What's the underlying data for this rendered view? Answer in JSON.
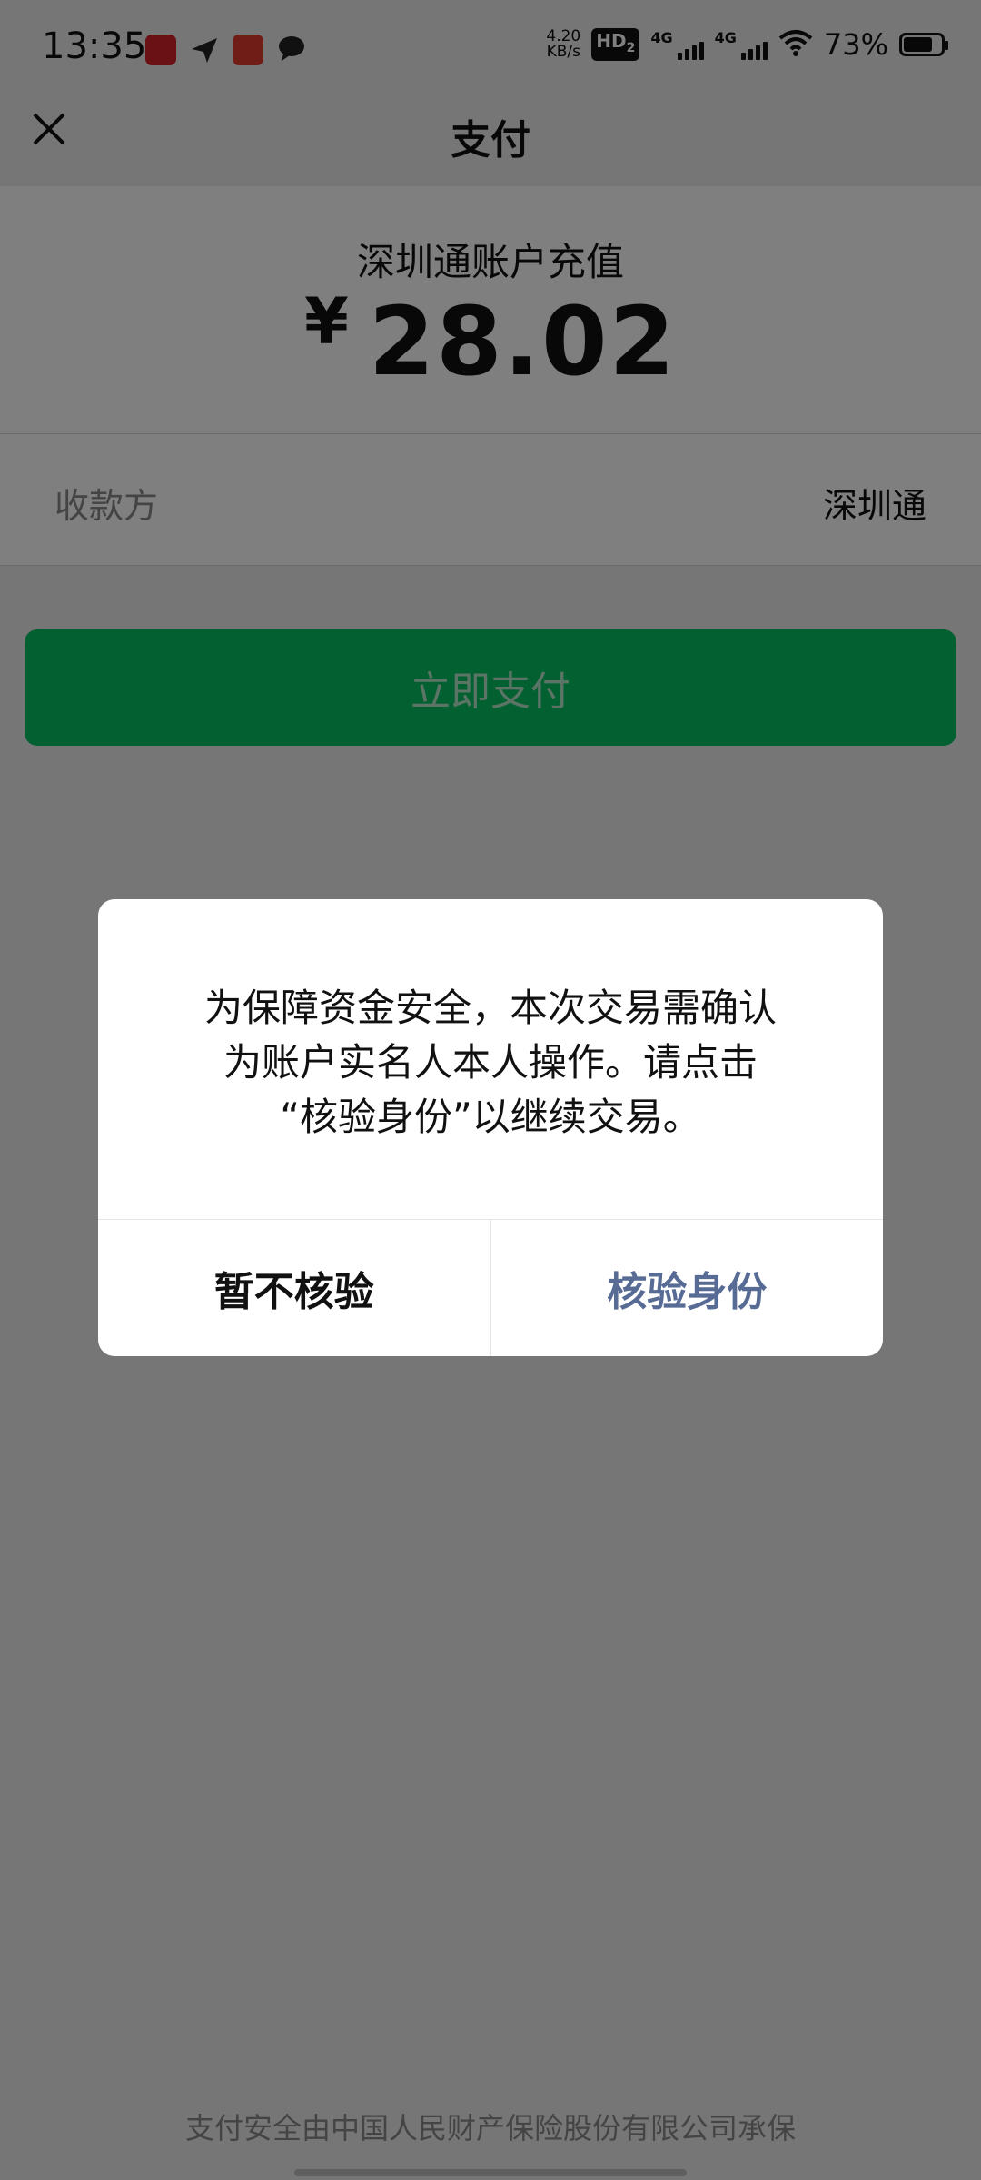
{
  "status_bar": {
    "time": "13:35",
    "net_speed_value": "4.20",
    "net_speed_unit": "KB/s",
    "hd_label": "HD",
    "hd_sub": "2",
    "net1_label": "4G",
    "net2_label": "4G",
    "battery_percent": "73%"
  },
  "header": {
    "title": "支付"
  },
  "payment": {
    "description": "深圳通账户充值",
    "currency_symbol": "¥",
    "amount": "28.02"
  },
  "payee": {
    "label": "收款方",
    "value": "深圳通"
  },
  "pay_button": {
    "label": "立即支付"
  },
  "dialog": {
    "message_lines": [
      "为保障资金安全，本次交易需确认",
      "为账户实名人本人操作。请点击",
      "“核验身份”以继续交易。"
    ],
    "cancel_label": "暂不核验",
    "confirm_label": "核验身份"
  },
  "footer": {
    "insurance_text": "支付安全由中国人民财产保险股份有限公司承保"
  },
  "colors": {
    "primary_green": "#07c160",
    "link_blue": "#576b95",
    "overlay": "rgba(0,0,0,0.5)"
  }
}
